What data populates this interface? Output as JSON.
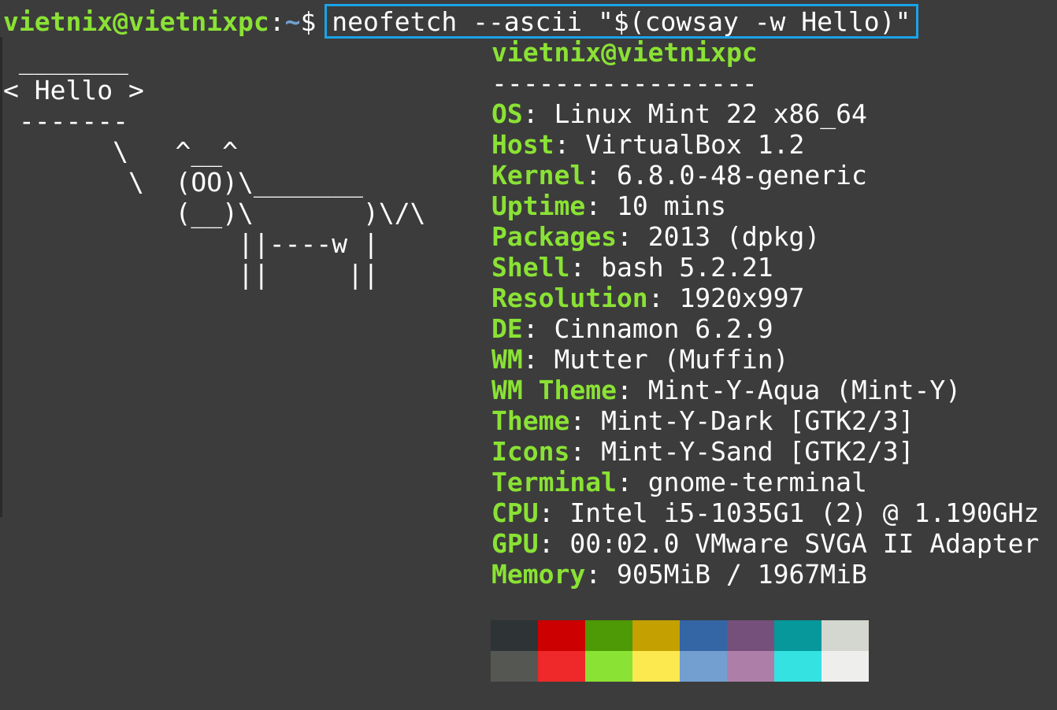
{
  "prompt": {
    "user_host": "vietnix@vietnixpc",
    "separator": ":",
    "path": "~",
    "symbol": "$",
    "command": "neofetch --ascii \"$(cowsay -w Hello)\""
  },
  "cowsay_ascii": " _______\n< Hello >\n -------\n       \\   ^__^\n        \\  (OO)\\_______\n           (__)\\       )\\/\\\n               ||----w |\n               ||     ||",
  "neofetch": {
    "title": "vietnix@vietnixpc",
    "underline": "-----------------",
    "fields": [
      {
        "key": "OS",
        "value": "Linux Mint 22 x86_64"
      },
      {
        "key": "Host",
        "value": "VirtualBox 1.2"
      },
      {
        "key": "Kernel",
        "value": "6.8.0-48-generic"
      },
      {
        "key": "Uptime",
        "value": "10 mins"
      },
      {
        "key": "Packages",
        "value": "2013 (dpkg)"
      },
      {
        "key": "Shell",
        "value": "bash 5.2.21"
      },
      {
        "key": "Resolution",
        "value": "1920x997"
      },
      {
        "key": "DE",
        "value": "Cinnamon 6.2.9"
      },
      {
        "key": "WM",
        "value": "Mutter (Muffin)"
      },
      {
        "key": "WM Theme",
        "value": "Mint-Y-Aqua (Mint-Y)"
      },
      {
        "key": "Theme",
        "value": "Mint-Y-Dark [GTK2/3]"
      },
      {
        "key": "Icons",
        "value": "Mint-Y-Sand [GTK2/3]"
      },
      {
        "key": "Terminal",
        "value": "gnome-terminal"
      },
      {
        "key": "CPU",
        "value": "Intel i5-1035G1 (2) @ 1.190GHz"
      },
      {
        "key": "GPU",
        "value": "00:02.0 VMware SVGA II Adapter"
      },
      {
        "key": "Memory",
        "value": "905MiB / 1967MiB"
      }
    ]
  },
  "colors": {
    "accent_green": "#8ae234",
    "path_blue": "#729fcf",
    "highlight_border": "#1aa3e8",
    "background": "#3c3c3c"
  },
  "palette": [
    "#2e3436",
    "#cc0000",
    "#4e9a06",
    "#c4a000",
    "#3465a4",
    "#75507b",
    "#06989a",
    "#d3d7cf",
    "#555753",
    "#ef2929",
    "#8ae234",
    "#fce94f",
    "#729fcf",
    "#ad7fa8",
    "#34e2e2",
    "#eeeeec"
  ]
}
